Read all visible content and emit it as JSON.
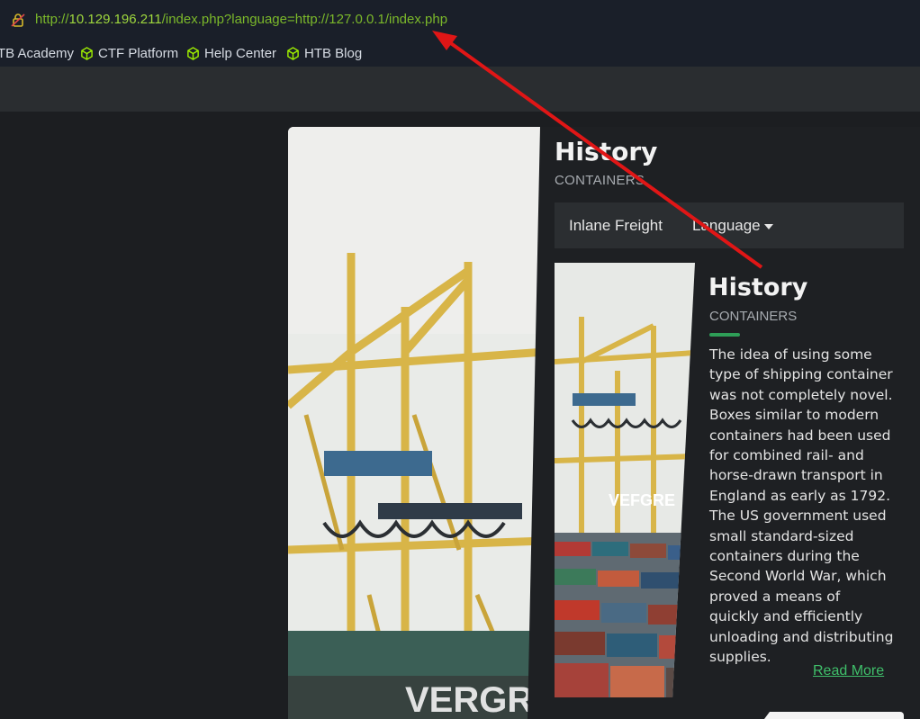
{
  "browser": {
    "url_host_prefix": "http://",
    "url_host": "10.129.196.211",
    "url_rest": "/index.php?language=http://127.0.0.1/index.php",
    "bookmarks": [
      {
        "label": "TB Academy",
        "icon": "cube-icon"
      },
      {
        "label": "CTF Platform",
        "icon": "cube-icon"
      },
      {
        "label": "Help Center",
        "icon": "cube-icon"
      },
      {
        "label": "HTB Blog",
        "icon": "cube-icon"
      }
    ]
  },
  "page": {
    "header_title": "History",
    "header_subtitle": "CONTAINERS",
    "nav": {
      "brand": "Inlane Freight",
      "language": "Language"
    },
    "card": {
      "title": "History",
      "subtitle": "CONTAINERS",
      "body": "The idea of using some type of shipping container was not completely novel. Boxes similar to modern containers had been used for combined rail- and horse-drawn transport in England as early as 1792. The US government used small standard-sized containers during the Second World War, which proved a means of quickly and efficiently unloading and distributing supplies.",
      "read_more": "Read More"
    }
  },
  "colors": {
    "accent": "#2e9e57",
    "link": "#3fbf6a",
    "url": "#7bb82a",
    "arrow": "#e01616"
  }
}
